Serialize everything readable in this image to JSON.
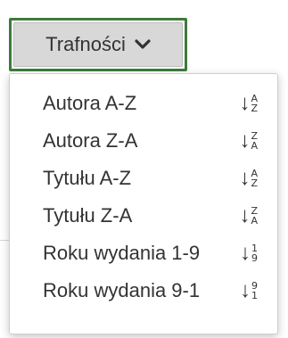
{
  "sort": {
    "current_label": "Trafności",
    "icon": "chevron-down-icon",
    "options": [
      {
        "label": "Autora A-Z",
        "icon": "sort-alpha-asc-icon",
        "top": "A",
        "bottom": "Z"
      },
      {
        "label": "Autora Z-A",
        "icon": "sort-alpha-desc-icon",
        "top": "Z",
        "bottom": "A"
      },
      {
        "label": "Tytułu A-Z",
        "icon": "sort-alpha-asc-icon",
        "top": "A",
        "bottom": "Z"
      },
      {
        "label": "Tytułu Z-A",
        "icon": "sort-alpha-desc-icon",
        "top": "Z",
        "bottom": "A"
      },
      {
        "label": "Roku wydania 1-9",
        "icon": "sort-numeric-asc-icon",
        "top": "1",
        "bottom": "9"
      },
      {
        "label": "Roku wydania 9-1",
        "icon": "sort-numeric-desc-icon",
        "top": "9",
        "bottom": "1"
      }
    ]
  },
  "colors": {
    "focus_border": "#3f7a3b",
    "button_bg": "#d8d8d8",
    "text": "#333333"
  }
}
